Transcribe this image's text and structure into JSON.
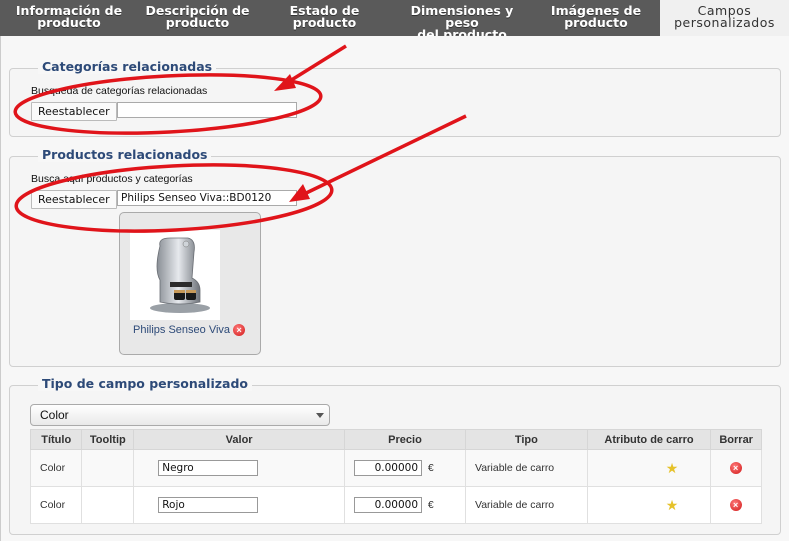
{
  "tabs": [
    {
      "label": "Información de\nproducto"
    },
    {
      "label": "Descripción de\nproducto"
    },
    {
      "label": "Estado de producto"
    },
    {
      "label": "Dimensiones y peso\ndel producto"
    },
    {
      "label": "Imágenes de\nproducto"
    },
    {
      "label": "Campos\npersonalizados",
      "active": true
    }
  ],
  "categories": {
    "legend": "Categorías relacionadas",
    "search_label": "Busqueda de categorías relacionadas",
    "reset_label": "Reestablecer",
    "input_value": ""
  },
  "products": {
    "legend": "Productos relacionados",
    "search_label": "Busca aquí productos y categorías",
    "reset_label": "Reestablecer",
    "input_value": "Philips Senseo Viva::BD0120",
    "item_name": "Philips Senseo Viva"
  },
  "custom": {
    "legend": "Tipo de campo personalizado",
    "select_value": "Color",
    "headers": [
      "Título",
      "Tooltip",
      "Valor",
      "Precio",
      "Tipo",
      "Atributo de carro",
      "Borrar"
    ],
    "rows": [
      {
        "title": "Color",
        "tooltip": "",
        "value": "Negro",
        "price": "0.00000",
        "currency": "€",
        "type": "Variable de carro"
      },
      {
        "title": "Color",
        "tooltip": "",
        "value": "Rojo",
        "price": "0.00000",
        "currency": "€",
        "type": "Variable de carro"
      }
    ]
  },
  "colors": {
    "annotation": "#e0141a",
    "legend": "#2d4a78",
    "tabbar": "#5a5a5a"
  }
}
